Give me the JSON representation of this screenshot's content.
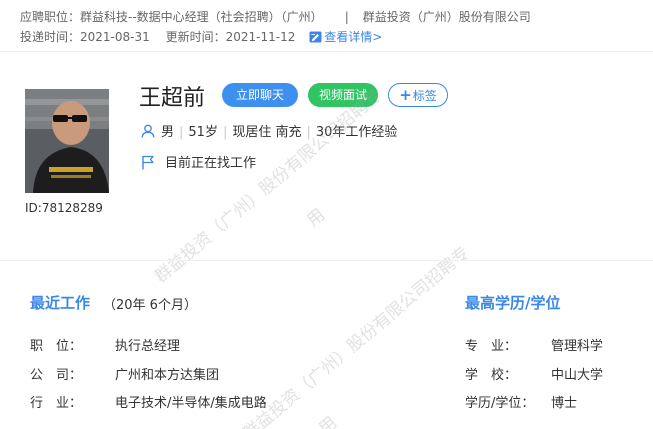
{
  "header": {
    "position_label": "应聘职位：",
    "position_value": "群益科技--数据中心经理（社会招聘）（广州）",
    "separator": "|",
    "company": "群益投资（广州）股份有限公司",
    "submitted_label": "投递时间：",
    "submitted_value": "2021-08-31",
    "updated_label": "更新时间：",
    "updated_value": "2021-11-12",
    "detail_link": "查看详情>"
  },
  "profile": {
    "name": "王超前",
    "id_text": "ID:78128289",
    "buttons": {
      "chat": "立即聊天",
      "video": "视频面试",
      "tag": "标签"
    },
    "gender": "男",
    "age": "51岁",
    "residence": "现居住 南充",
    "experience": "30年工作经验",
    "job_status": "目前正在找工作",
    "separator": "|"
  },
  "watermark": {
    "line1": "群益投资（广州）股份有限公司招聘专",
    "line2": "用"
  },
  "recent_work": {
    "title": "最近工作",
    "duration": "（20年 6个月）",
    "fields": [
      {
        "label": "职　位：",
        "value": "执行总经理"
      },
      {
        "label": "公　司：",
        "value": "广州和本方达集团"
      },
      {
        "label": "行　业：",
        "value": "电子技术/半导体/集成电路"
      }
    ]
  },
  "education": {
    "title": "最高学历/学位",
    "fields": [
      {
        "label": "专　业：",
        "value": "管理科学"
      },
      {
        "label": "学　校：",
        "value": "中山大学"
      },
      {
        "label": "学历/学位：",
        "value": "博士"
      }
    ]
  },
  "colors": {
    "accent": "#3a87e8",
    "chat_button": "#3d8ff0",
    "video_button": "#30c463",
    "text": "#333333",
    "muted": "#666666"
  },
  "icons": {
    "detail": "edit-icon",
    "person": "person-icon",
    "flag": "flag-icon",
    "plus": "plus-icon"
  }
}
